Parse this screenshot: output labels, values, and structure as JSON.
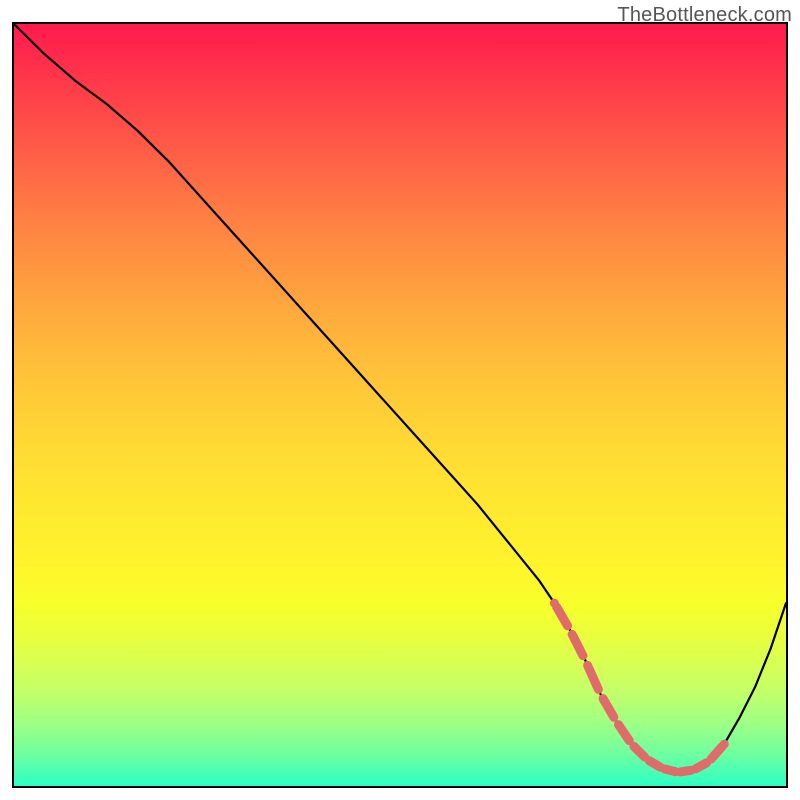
{
  "watermark": "TheBottleneck.com",
  "chart_data": {
    "type": "line",
    "title": "",
    "xlabel": "",
    "ylabel": "",
    "xlim": [
      0,
      100
    ],
    "ylim": [
      0,
      100
    ],
    "series": [
      {
        "name": "bottleneck-curve",
        "x": [
          0,
          4,
          8,
          12,
          16,
          20,
          24,
          28,
          32,
          36,
          40,
          44,
          48,
          52,
          56,
          60,
          64,
          68,
          70,
          72,
          74,
          76,
          78,
          80,
          82,
          84,
          86,
          88,
          90,
          92,
          94,
          96,
          98,
          100
        ],
        "y": [
          100,
          96,
          92.5,
          89.5,
          86,
          82,
          77.5,
          73,
          68.5,
          64,
          59.5,
          55,
          50.5,
          46,
          41.5,
          37,
          32,
          27,
          24,
          20.5,
          16.5,
          12,
          8.5,
          5.5,
          3.5,
          2.3,
          1.8,
          2.1,
          3.2,
          5.5,
          9,
          13,
          18,
          24
        ]
      }
    ],
    "marker_points": {
      "name": "highlight-beads",
      "style": "dashed-pink",
      "x": [
        70,
        72,
        74,
        76,
        78,
        80,
        82,
        84,
        86,
        88,
        90,
        92
      ],
      "y": [
        24,
        20.5,
        16.5,
        12,
        8.5,
        5.5,
        3.5,
        2.3,
        1.8,
        2.1,
        3.2,
        5.5
      ]
    },
    "gradient_stops": [
      {
        "pos": 0.0,
        "color": "#ff1a4d"
      },
      {
        "pos": 0.5,
        "color": "#ffdb34"
      },
      {
        "pos": 0.8,
        "color": "#eaff3c"
      },
      {
        "pos": 1.0,
        "color": "#2affc4"
      }
    ]
  }
}
